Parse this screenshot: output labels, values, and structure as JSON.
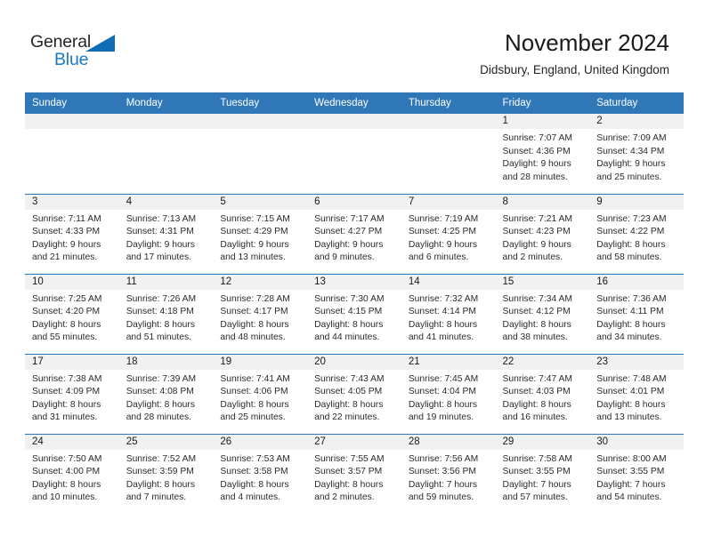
{
  "logo": {
    "word_top": "General",
    "word_bottom": "Blue",
    "triangle_icon": "triangle-icon",
    "blue": "#1b7ac4"
  },
  "header": {
    "title": "November 2024",
    "location": "Didsbury, England, United Kingdom"
  },
  "colors": {
    "header_blue": "#3077b8",
    "daynum_band": "#f1f1f1",
    "text": "#2b2b2b"
  },
  "calendar": {
    "weekday_headers": [
      "Sunday",
      "Monday",
      "Tuesday",
      "Wednesday",
      "Thursday",
      "Friday",
      "Saturday"
    ],
    "weeks": [
      [
        {
          "day": "",
          "empty": true
        },
        {
          "day": "",
          "empty": true
        },
        {
          "day": "",
          "empty": true
        },
        {
          "day": "",
          "empty": true
        },
        {
          "day": "",
          "empty": true
        },
        {
          "day": "1",
          "sunrise": "Sunrise: 7:07 AM",
          "sunset": "Sunset: 4:36 PM",
          "daylight_1": "Daylight: 9 hours",
          "daylight_2": "and 28 minutes."
        },
        {
          "day": "2",
          "sunrise": "Sunrise: 7:09 AM",
          "sunset": "Sunset: 4:34 PM",
          "daylight_1": "Daylight: 9 hours",
          "daylight_2": "and 25 minutes."
        }
      ],
      [
        {
          "day": "3",
          "sunrise": "Sunrise: 7:11 AM",
          "sunset": "Sunset: 4:33 PM",
          "daylight_1": "Daylight: 9 hours",
          "daylight_2": "and 21 minutes."
        },
        {
          "day": "4",
          "sunrise": "Sunrise: 7:13 AM",
          "sunset": "Sunset: 4:31 PM",
          "daylight_1": "Daylight: 9 hours",
          "daylight_2": "and 17 minutes."
        },
        {
          "day": "5",
          "sunrise": "Sunrise: 7:15 AM",
          "sunset": "Sunset: 4:29 PM",
          "daylight_1": "Daylight: 9 hours",
          "daylight_2": "and 13 minutes."
        },
        {
          "day": "6",
          "sunrise": "Sunrise: 7:17 AM",
          "sunset": "Sunset: 4:27 PM",
          "daylight_1": "Daylight: 9 hours",
          "daylight_2": "and 9 minutes."
        },
        {
          "day": "7",
          "sunrise": "Sunrise: 7:19 AM",
          "sunset": "Sunset: 4:25 PM",
          "daylight_1": "Daylight: 9 hours",
          "daylight_2": "and 6 minutes."
        },
        {
          "day": "8",
          "sunrise": "Sunrise: 7:21 AM",
          "sunset": "Sunset: 4:23 PM",
          "daylight_1": "Daylight: 9 hours",
          "daylight_2": "and 2 minutes."
        },
        {
          "day": "9",
          "sunrise": "Sunrise: 7:23 AM",
          "sunset": "Sunset: 4:22 PM",
          "daylight_1": "Daylight: 8 hours",
          "daylight_2": "and 58 minutes."
        }
      ],
      [
        {
          "day": "10",
          "sunrise": "Sunrise: 7:25 AM",
          "sunset": "Sunset: 4:20 PM",
          "daylight_1": "Daylight: 8 hours",
          "daylight_2": "and 55 minutes."
        },
        {
          "day": "11",
          "sunrise": "Sunrise: 7:26 AM",
          "sunset": "Sunset: 4:18 PM",
          "daylight_1": "Daylight: 8 hours",
          "daylight_2": "and 51 minutes."
        },
        {
          "day": "12",
          "sunrise": "Sunrise: 7:28 AM",
          "sunset": "Sunset: 4:17 PM",
          "daylight_1": "Daylight: 8 hours",
          "daylight_2": "and 48 minutes."
        },
        {
          "day": "13",
          "sunrise": "Sunrise: 7:30 AM",
          "sunset": "Sunset: 4:15 PM",
          "daylight_1": "Daylight: 8 hours",
          "daylight_2": "and 44 minutes."
        },
        {
          "day": "14",
          "sunrise": "Sunrise: 7:32 AM",
          "sunset": "Sunset: 4:14 PM",
          "daylight_1": "Daylight: 8 hours",
          "daylight_2": "and 41 minutes."
        },
        {
          "day": "15",
          "sunrise": "Sunrise: 7:34 AM",
          "sunset": "Sunset: 4:12 PM",
          "daylight_1": "Daylight: 8 hours",
          "daylight_2": "and 38 minutes."
        },
        {
          "day": "16",
          "sunrise": "Sunrise: 7:36 AM",
          "sunset": "Sunset: 4:11 PM",
          "daylight_1": "Daylight: 8 hours",
          "daylight_2": "and 34 minutes."
        }
      ],
      [
        {
          "day": "17",
          "sunrise": "Sunrise: 7:38 AM",
          "sunset": "Sunset: 4:09 PM",
          "daylight_1": "Daylight: 8 hours",
          "daylight_2": "and 31 minutes."
        },
        {
          "day": "18",
          "sunrise": "Sunrise: 7:39 AM",
          "sunset": "Sunset: 4:08 PM",
          "daylight_1": "Daylight: 8 hours",
          "daylight_2": "and 28 minutes."
        },
        {
          "day": "19",
          "sunrise": "Sunrise: 7:41 AM",
          "sunset": "Sunset: 4:06 PM",
          "daylight_1": "Daylight: 8 hours",
          "daylight_2": "and 25 minutes."
        },
        {
          "day": "20",
          "sunrise": "Sunrise: 7:43 AM",
          "sunset": "Sunset: 4:05 PM",
          "daylight_1": "Daylight: 8 hours",
          "daylight_2": "and 22 minutes."
        },
        {
          "day": "21",
          "sunrise": "Sunrise: 7:45 AM",
          "sunset": "Sunset: 4:04 PM",
          "daylight_1": "Daylight: 8 hours",
          "daylight_2": "and 19 minutes."
        },
        {
          "day": "22",
          "sunrise": "Sunrise: 7:47 AM",
          "sunset": "Sunset: 4:03 PM",
          "daylight_1": "Daylight: 8 hours",
          "daylight_2": "and 16 minutes."
        },
        {
          "day": "23",
          "sunrise": "Sunrise: 7:48 AM",
          "sunset": "Sunset: 4:01 PM",
          "daylight_1": "Daylight: 8 hours",
          "daylight_2": "and 13 minutes."
        }
      ],
      [
        {
          "day": "24",
          "sunrise": "Sunrise: 7:50 AM",
          "sunset": "Sunset: 4:00 PM",
          "daylight_1": "Daylight: 8 hours",
          "daylight_2": "and 10 minutes."
        },
        {
          "day": "25",
          "sunrise": "Sunrise: 7:52 AM",
          "sunset": "Sunset: 3:59 PM",
          "daylight_1": "Daylight: 8 hours",
          "daylight_2": "and 7 minutes."
        },
        {
          "day": "26",
          "sunrise": "Sunrise: 7:53 AM",
          "sunset": "Sunset: 3:58 PM",
          "daylight_1": "Daylight: 8 hours",
          "daylight_2": "and 4 minutes."
        },
        {
          "day": "27",
          "sunrise": "Sunrise: 7:55 AM",
          "sunset": "Sunset: 3:57 PM",
          "daylight_1": "Daylight: 8 hours",
          "daylight_2": "and 2 minutes."
        },
        {
          "day": "28",
          "sunrise": "Sunrise: 7:56 AM",
          "sunset": "Sunset: 3:56 PM",
          "daylight_1": "Daylight: 7 hours",
          "daylight_2": "and 59 minutes."
        },
        {
          "day": "29",
          "sunrise": "Sunrise: 7:58 AM",
          "sunset": "Sunset: 3:55 PM",
          "daylight_1": "Daylight: 7 hours",
          "daylight_2": "and 57 minutes."
        },
        {
          "day": "30",
          "sunrise": "Sunrise: 8:00 AM",
          "sunset": "Sunset: 3:55 PM",
          "daylight_1": "Daylight: 7 hours",
          "daylight_2": "and 54 minutes."
        }
      ]
    ]
  }
}
